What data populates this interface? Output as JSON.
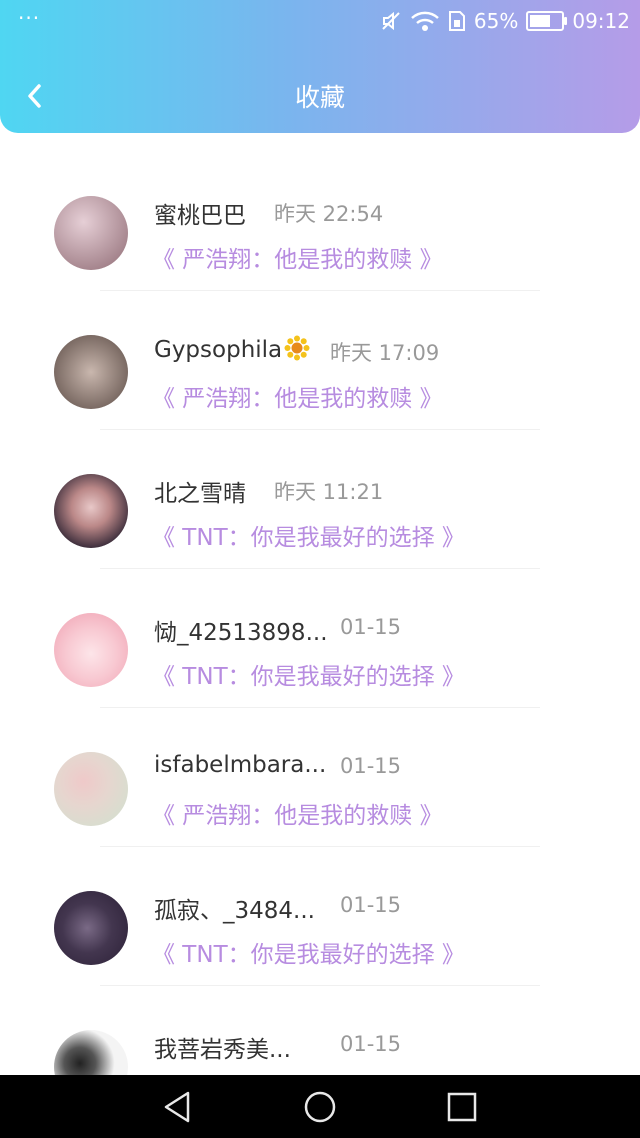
{
  "status": {
    "dots": "···",
    "battery": "65%",
    "battery_level": 0.65,
    "time": "09:12"
  },
  "header": {
    "title": "收藏"
  },
  "items": [
    {
      "name": "蜜桃巴巴",
      "time": "昨天 22:54",
      "content": "《 严浩翔：他是我的救赎 》",
      "avatar_colors": [
        "#e6cfd6",
        "#8f6b74"
      ]
    },
    {
      "name": "Gypsophila",
      "badge": "sunflower",
      "time": "昨天 17:09",
      "content": "《 严浩翔：他是我的救赎 》",
      "avatar_colors": [
        "#5a4a44",
        "#c9b7ae"
      ]
    },
    {
      "name": "北之雪晴",
      "time": "昨天 11:21",
      "content": "《 TNT：你是我最好的选择 》",
      "avatar_colors": [
        "#3a2c3a",
        "#e8c8c8"
      ]
    },
    {
      "name": "恸_42513898...",
      "time": "01-15",
      "content": "《 TNT：你是我最好的选择 》",
      "avatar_colors": [
        "#f8c9d2",
        "#ef9fb0"
      ]
    },
    {
      "name": "isfabelmbara...",
      "time": "01-15",
      "content": "《 严浩翔：他是我的救赎 》",
      "avatar_colors": [
        "#cfe2cf",
        "#efc9c9"
      ]
    },
    {
      "name": "孤寂、_3484...",
      "time": "01-15",
      "content": "《 TNT：你是我最好的选择 》",
      "avatar_colors": [
        "#2b2036",
        "#7a6a86"
      ]
    },
    {
      "name": "我菩岩秀美...",
      "time": "01-15",
      "content": "",
      "avatar_colors": [
        "#f4f4f4",
        "#222222"
      ]
    }
  ],
  "colors": {
    "accent": "#b78ce0",
    "header_start": "#4fd6f2",
    "header_end": "#b59ce8"
  },
  "nav": {
    "back": "triangle",
    "home": "circle",
    "recents": "square"
  }
}
